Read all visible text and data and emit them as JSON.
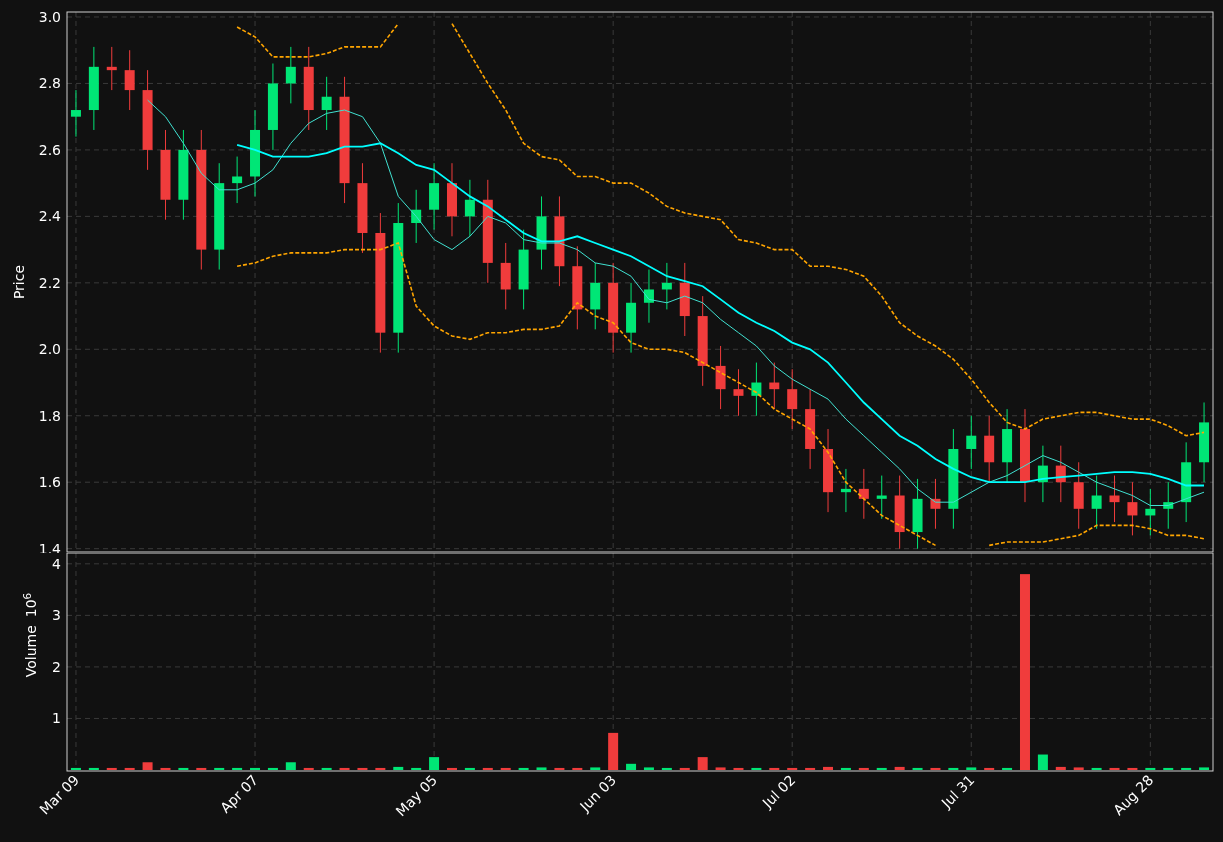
{
  "price_panel": {
    "chart_data": {
      "type": "candlestick",
      "ylabel": "Price",
      "grid": true,
      "categories": [
        null,
        null,
        null,
        null,
        null,
        null,
        null,
        null,
        null,
        null,
        null,
        null,
        null,
        null,
        null,
        null,
        null,
        null,
        null,
        null,
        null,
        null,
        null,
        null,
        null,
        null,
        null,
        null,
        null,
        null,
        null,
        null,
        null,
        null,
        null,
        null,
        null,
        null,
        null,
        null,
        null,
        null,
        null,
        null,
        null,
        null,
        null,
        null,
        null,
        null,
        null,
        null,
        null,
        null,
        null,
        null,
        null,
        null,
        null,
        null,
        null,
        null,
        null,
        null
      ],
      "ylim": [
        1.39,
        3.015
      ],
      "yticks": [
        {
          "value": 1.4,
          "label": "1.4"
        },
        {
          "value": 1.6,
          "label": "1.6"
        },
        {
          "value": 1.8,
          "label": "1.8"
        },
        {
          "value": 2.0,
          "label": "2.0"
        },
        {
          "value": 2.2,
          "label": "2.2"
        },
        {
          "value": 2.4,
          "label": "2.4"
        },
        {
          "value": 2.6,
          "label": "2.6"
        },
        {
          "value": 2.8,
          "label": "2.8"
        },
        {
          "value": 3.0,
          "label": "3.0"
        }
      ],
      "series": [
        {
          "type": "line",
          "color": "#40e0d0",
          "line_style": "solid",
          "values": [
            null,
            null,
            null,
            null,
            2.75,
            2.7,
            2.62,
            2.53,
            2.48,
            2.48,
            2.5,
            2.54,
            2.62,
            2.68,
            2.71,
            2.72,
            2.7,
            2.62,
            2.46,
            2.4,
            2.33,
            2.3,
            2.34,
            2.4,
            2.38,
            2.33,
            2.32,
            2.32,
            2.3,
            2.26,
            2.25,
            2.22,
            2.15,
            2.14,
            2.16,
            2.14,
            2.09,
            2.05,
            2.01,
            1.95,
            1.91,
            1.88,
            1.85,
            1.79,
            1.74,
            1.69,
            1.64,
            1.58,
            1.54,
            1.54,
            1.57,
            1.6,
            1.62,
            1.65,
            1.68,
            1.66,
            1.63,
            1.6,
            1.58,
            1.56,
            1.53,
            1.53,
            1.55,
            1.57
          ]
        },
        {
          "type": "line",
          "color": "#00ffff",
          "line_style": "solid",
          "values": [
            null,
            null,
            null,
            null,
            null,
            null,
            null,
            null,
            null,
            2.615,
            2.6,
            2.58,
            2.58,
            2.58,
            2.59,
            2.61,
            2.61,
            2.62,
            2.59,
            2.555,
            2.54,
            2.5,
            2.46,
            2.43,
            2.39,
            2.35,
            2.325,
            2.325,
            2.34,
            2.32,
            2.3,
            2.28,
            2.25,
            2.22,
            2.205,
            2.19,
            2.15,
            2.11,
            2.08,
            2.055,
            2.02,
            2.0,
            1.96,
            1.9,
            1.84,
            1.79,
            1.74,
            1.71,
            1.67,
            1.64,
            1.615,
            1.6,
            1.6,
            1.6,
            1.61,
            1.615,
            1.62,
            1.625,
            1.63,
            1.63,
            1.625,
            1.61,
            1.59,
            1.59
          ]
        },
        {
          "type": "line",
          "color": "#ffa500",
          "line_style": "dashed",
          "values": [
            null,
            null,
            null,
            null,
            null,
            null,
            null,
            null,
            null,
            2.97,
            2.94,
            2.88,
            2.88,
            2.88,
            2.89,
            2.91,
            2.91,
            2.91,
            2.98,
            null,
            null,
            2.98,
            2.89,
            2.8,
            2.72,
            2.62,
            2.58,
            2.57,
            2.52,
            2.52,
            2.5,
            2.5,
            2.47,
            2.43,
            2.41,
            2.4,
            2.39,
            2.33,
            2.32,
            2.3,
            2.3,
            2.25,
            2.25,
            2.24,
            2.22,
            2.16,
            2.08,
            2.04,
            2.01,
            1.97,
            1.91,
            1.84,
            1.78,
            1.76,
            1.79,
            1.8,
            1.81,
            1.81,
            1.8,
            1.79,
            1.79,
            1.77,
            1.74,
            1.75
          ]
        },
        {
          "type": "line",
          "color": "#ffa500",
          "line_style": "dashed",
          "values": [
            null,
            null,
            null,
            null,
            null,
            null,
            null,
            null,
            null,
            2.25,
            2.26,
            2.28,
            2.29,
            2.29,
            2.29,
            2.3,
            2.3,
            2.3,
            2.32,
            2.13,
            2.07,
            2.04,
            2.03,
            2.05,
            2.05,
            2.06,
            2.06,
            2.07,
            2.14,
            2.1,
            2.08,
            2.02,
            2.0,
            2.0,
            1.99,
            1.96,
            1.93,
            1.9,
            1.87,
            1.82,
            1.79,
            1.76,
            1.69,
            1.6,
            1.55,
            1.5,
            1.47,
            1.44,
            1.41,
            null,
            null,
            1.41,
            1.42,
            1.42,
            1.42,
            1.43,
            1.44,
            1.47,
            1.47,
            1.47,
            1.46,
            1.44,
            1.44,
            1.43
          ]
        }
      ],
      "ohlc": [
        [
          2.7,
          2.78,
          2.64,
          2.72
        ],
        [
          2.72,
          2.91,
          2.66,
          2.85
        ],
        [
          2.85,
          2.91,
          2.78,
          2.84
        ],
        [
          2.84,
          2.9,
          2.72,
          2.78
        ],
        [
          2.78,
          2.84,
          2.54,
          2.6
        ],
        [
          2.6,
          2.66,
          2.39,
          2.45
        ],
        [
          2.45,
          2.66,
          2.39,
          2.6
        ],
        [
          2.6,
          2.66,
          2.24,
          2.3
        ],
        [
          2.3,
          2.56,
          2.24,
          2.5
        ],
        [
          2.5,
          2.58,
          2.44,
          2.52
        ],
        [
          2.52,
          2.72,
          2.46,
          2.66
        ],
        [
          2.66,
          2.86,
          2.6,
          2.8
        ],
        [
          2.8,
          2.91,
          2.74,
          2.85
        ],
        [
          2.85,
          2.91,
          2.66,
          2.72
        ],
        [
          2.72,
          2.82,
          2.66,
          2.76
        ],
        [
          2.76,
          2.82,
          2.44,
          2.5
        ],
        [
          2.5,
          2.56,
          2.29,
          2.35
        ],
        [
          2.35,
          2.41,
          1.99,
          2.05
        ],
        [
          2.05,
          2.44,
          1.99,
          2.38
        ],
        [
          2.38,
          2.48,
          2.32,
          2.42
        ],
        [
          2.42,
          2.56,
          2.36,
          2.5
        ],
        [
          2.5,
          2.56,
          2.34,
          2.4
        ],
        [
          2.4,
          2.51,
          2.34,
          2.45
        ],
        [
          2.45,
          2.51,
          2.2,
          2.26
        ],
        [
          2.26,
          2.32,
          2.12,
          2.18
        ],
        [
          2.18,
          2.36,
          2.12,
          2.3
        ],
        [
          2.3,
          2.46,
          2.24,
          2.4
        ],
        [
          2.4,
          2.46,
          2.19,
          2.25
        ],
        [
          2.25,
          2.31,
          2.06,
          2.12
        ],
        [
          2.12,
          2.26,
          2.06,
          2.2
        ],
        [
          2.2,
          2.26,
          1.99,
          2.05
        ],
        [
          2.05,
          2.2,
          1.99,
          2.14
        ],
        [
          2.14,
          2.24,
          2.08,
          2.18
        ],
        [
          2.18,
          2.26,
          2.12,
          2.2
        ],
        [
          2.2,
          2.26,
          2.04,
          2.1
        ],
        [
          2.1,
          2.16,
          1.89,
          1.95
        ],
        [
          1.95,
          2.01,
          1.82,
          1.88
        ],
        [
          1.88,
          1.94,
          1.8,
          1.86
        ],
        [
          1.86,
          1.96,
          1.8,
          1.9
        ],
        [
          1.9,
          1.96,
          1.82,
          1.88
        ],
        [
          1.88,
          1.94,
          1.76,
          1.82
        ],
        [
          1.82,
          1.88,
          1.64,
          1.7
        ],
        [
          1.7,
          1.76,
          1.51,
          1.57
        ],
        [
          1.57,
          1.64,
          1.51,
          1.58
        ],
        [
          1.58,
          1.64,
          1.49,
          1.55
        ],
        [
          1.55,
          1.62,
          1.49,
          1.56
        ],
        [
          1.56,
          1.62,
          1.4,
          1.45
        ],
        [
          1.45,
          1.61,
          1.4,
          1.55
        ],
        [
          1.55,
          1.61,
          1.46,
          1.52
        ],
        [
          1.52,
          1.76,
          1.46,
          1.7
        ],
        [
          1.7,
          1.8,
          1.64,
          1.74
        ],
        [
          1.74,
          1.8,
          1.6,
          1.66
        ],
        [
          1.66,
          1.82,
          1.6,
          1.76
        ],
        [
          1.76,
          1.82,
          1.54,
          1.6
        ],
        [
          1.6,
          1.71,
          1.54,
          1.65
        ],
        [
          1.65,
          1.71,
          1.54,
          1.6
        ],
        [
          1.6,
          1.66,
          1.46,
          1.52
        ],
        [
          1.52,
          1.62,
          1.46,
          1.56
        ],
        [
          1.56,
          1.62,
          1.48,
          1.54
        ],
        [
          1.54,
          1.6,
          1.44,
          1.5
        ],
        [
          1.5,
          1.58,
          1.44,
          1.52
        ],
        [
          1.52,
          1.6,
          1.46,
          1.54
        ],
        [
          1.54,
          1.72,
          1.48,
          1.66
        ],
        [
          1.66,
          1.84,
          1.6,
          1.78
        ]
      ]
    }
  },
  "volume_panel": {
    "scale_label": "10$^{6}$",
    "chart_data": {
      "type": "bar",
      "ylabel": "Volume",
      "grid": true,
      "ylim": [
        0,
        4.21
      ],
      "yticks": [
        1,
        2,
        3,
        4
      ],
      "categories": [
        "Mar 09",
        null,
        null,
        null,
        null,
        null,
        null,
        null,
        null,
        null,
        "Apr 07",
        null,
        null,
        null,
        null,
        null,
        null,
        null,
        null,
        null,
        "May 05",
        null,
        null,
        null,
        null,
        null,
        null,
        null,
        null,
        null,
        "Jun 03",
        null,
        null,
        null,
        null,
        null,
        null,
        null,
        null,
        null,
        "Jul 02",
        null,
        null,
        null,
        null,
        null,
        null,
        null,
        null,
        null,
        "Jul 31",
        null,
        null,
        null,
        null,
        null,
        null,
        null,
        null,
        null,
        "Aug 28",
        null,
        null,
        null
      ],
      "values": [
        0.04,
        0.04,
        0.04,
        0.04,
        0.15,
        0.04,
        0.04,
        0.04,
        0.04,
        0.04,
        0.04,
        0.04,
        0.15,
        0.04,
        0.04,
        0.04,
        0.04,
        0.04,
        0.06,
        0.04,
        0.25,
        0.04,
        0.04,
        0.04,
        0.04,
        0.04,
        0.05,
        0.04,
        0.04,
        0.05,
        0.72,
        0.12,
        0.05,
        0.04,
        0.04,
        0.25,
        0.05,
        0.04,
        0.04,
        0.04,
        0.04,
        0.04,
        0.06,
        0.04,
        0.04,
        0.04,
        0.06,
        0.04,
        0.04,
        0.04,
        0.05,
        0.04,
        0.04,
        3.8,
        0.3,
        0.06,
        0.05,
        0.04,
        0.04,
        0.04,
        0.04,
        0.04,
        0.04,
        0.05
      ]
    }
  }
}
